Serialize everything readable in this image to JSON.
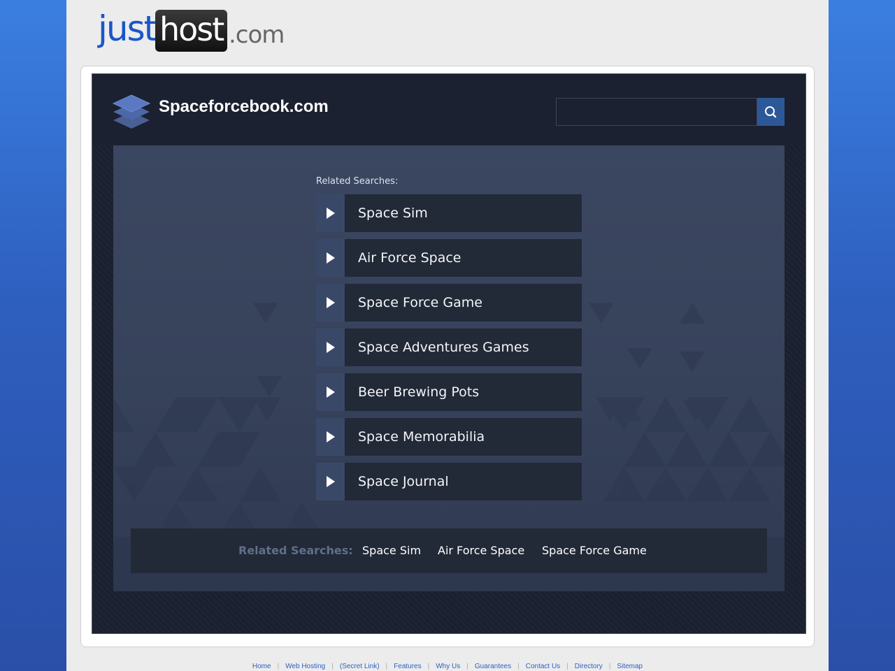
{
  "brand": {
    "just": "just",
    "host": "host",
    "dotcom": ".com"
  },
  "site": {
    "title": "Spaceforcebook.com"
  },
  "search": {
    "placeholder": ""
  },
  "related": {
    "heading": "Related Searches:",
    "items": [
      {
        "label": "Space Sim"
      },
      {
        "label": "Air Force Space"
      },
      {
        "label": "Space Force Game"
      },
      {
        "label": "Space Adventures Games"
      },
      {
        "label": "Beer Brewing Pots"
      },
      {
        "label": "Space Memorabilia"
      },
      {
        "label": "Space Journal"
      }
    ]
  },
  "bottom_bar": {
    "label": "Related Searches:",
    "links": [
      "Space Sim",
      "Air Force Space",
      "Space Force Game"
    ]
  },
  "footer": {
    "links": [
      "Home",
      "Web Hosting",
      "(Secret Link)",
      "Features",
      "Why Us",
      "Guarantees",
      "Contact Us",
      "Directory",
      "Sitemap"
    ],
    "separator": "|"
  },
  "colors": {
    "brand_blue": "#1a56c9",
    "search_button": "#2c5898",
    "item_background": "#222937",
    "arrow_box": "#3a4868"
  },
  "icons": {
    "site_logo": "stacked-layers-icon",
    "search_button": "magnifier-icon",
    "item_arrow": "play-arrow-icon"
  }
}
